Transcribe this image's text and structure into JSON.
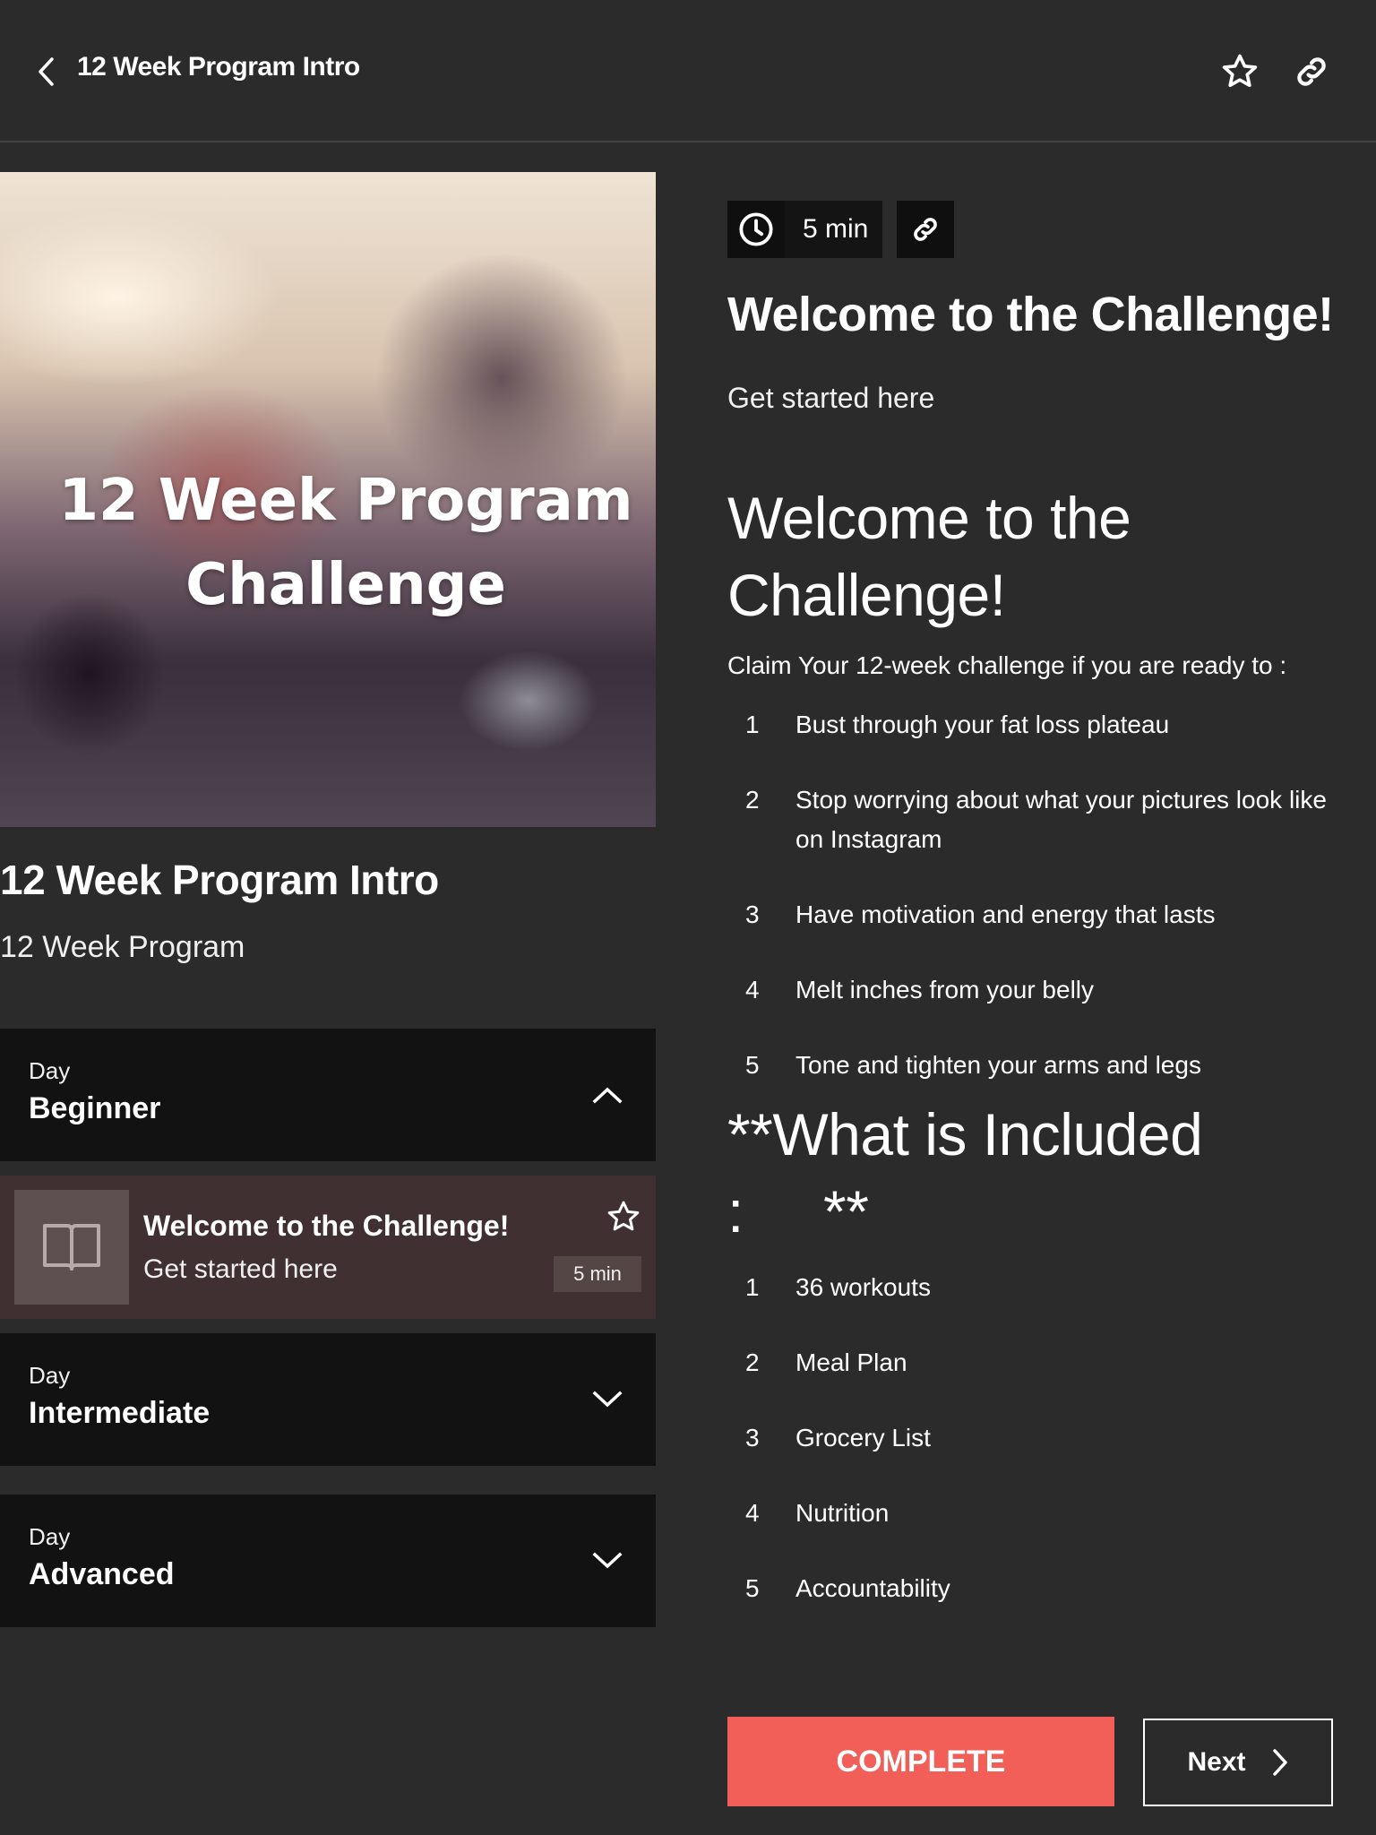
{
  "header": {
    "title": "12 Week Program Intro",
    "icons": [
      "back-chevron-icon",
      "star-icon",
      "link-icon"
    ]
  },
  "hero": {
    "overlay_text_line1": "12 Week Program",
    "overlay_text_line2": "Challenge"
  },
  "program": {
    "title": "12 Week Program Intro",
    "subtitle": "12 Week Program"
  },
  "sections": [
    {
      "kicker": "Day",
      "name": "Beginner",
      "expanded": true
    },
    {
      "kicker": "Day",
      "name": "Intermediate",
      "expanded": false
    },
    {
      "kicker": "Day",
      "name": "Advanced",
      "expanded": false
    }
  ],
  "lesson_card": {
    "title": "Welcome to the Challenge!",
    "subtitle": "Get started here",
    "duration": "5 min",
    "icon": "book-icon"
  },
  "lesson": {
    "duration": "5 min",
    "title": "Welcome to the Challenge!",
    "description": "Get started here",
    "body": {
      "heading": "Welcome to the Challenge!",
      "intro": "Claim Your 12-week challenge if you are ready to :",
      "goals": [
        {
          "num": "1",
          "text": "Bust through your fat loss plateau"
        },
        {
          "num": "2",
          "text": "Stop worrying about what your pictures look like on Instagram"
        },
        {
          "num": "3",
          "text": "Have motivation and energy that lasts"
        },
        {
          "num": "4",
          "text": "Melt inches from your belly"
        },
        {
          "num": "5",
          "text": "Tone and tighten your arms and legs"
        }
      ],
      "included_heading_line1": "**What is Included",
      "included_heading_line2": ":     **",
      "included": [
        {
          "num": "1",
          "text": "36 workouts"
        },
        {
          "num": "2",
          "text": "Meal Plan"
        },
        {
          "num": "3",
          "text": "Grocery List"
        },
        {
          "num": "4",
          "text": "Nutrition"
        },
        {
          "num": "5",
          "text": "Accountability"
        }
      ]
    }
  },
  "actions": {
    "complete_label": "COMPLETE",
    "next_label": "Next"
  },
  "colors": {
    "background": "#2b2b2b",
    "panel": "#121212",
    "lesson_card": "#413031",
    "accent": "#f25e58"
  }
}
